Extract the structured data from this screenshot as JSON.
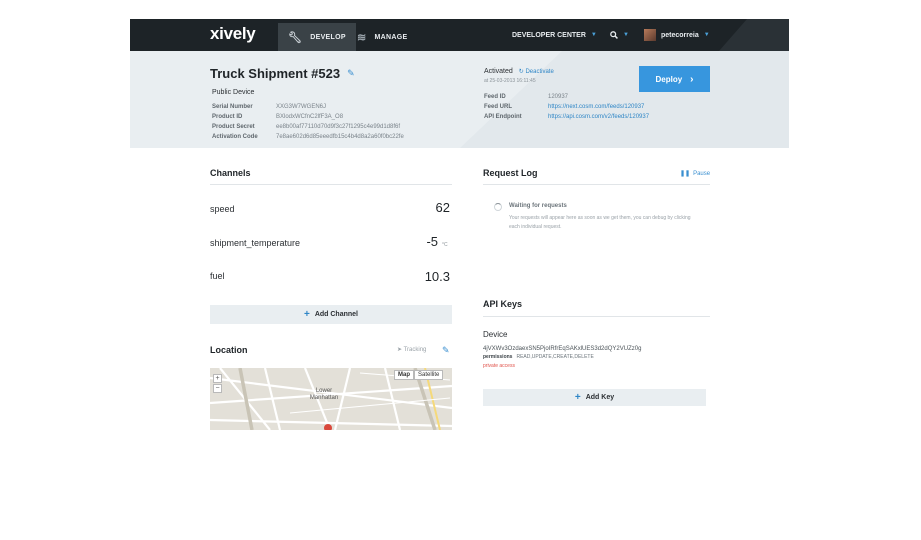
{
  "nav": {
    "logo": "xively",
    "develop": "DEVELOP",
    "manage": "MANAGE",
    "developer_center": "DEVELOPER CENTER",
    "username": "petecorreia"
  },
  "device": {
    "title": "Truck Shipment #523",
    "type": "Public Device",
    "fields": [
      {
        "label": "Serial Number",
        "value": "XXG3W7WGEN6J"
      },
      {
        "label": "Product ID",
        "value": "BXlodxWCfnC2lfF3A_O8"
      },
      {
        "label": "Product Secret",
        "value": "ee8b00af77110d70d9f3c27f1295c4e99d1d8f6f"
      },
      {
        "label": "Activation Code",
        "value": "7e8ae602d6d85eeedfb15c4b4d8a2a60f0bc22fe"
      }
    ],
    "status": "Activated",
    "deactivate": "Deactivate",
    "activated_at": "at 25-03-2013 16:11:45",
    "feed_fields": [
      {
        "label": "Feed ID",
        "value": "120937",
        "link": false
      },
      {
        "label": "Feed URL",
        "value": "https://next.cosm.com/feeds/120937",
        "link": true
      },
      {
        "label": "API Endpoint",
        "value": "https://api.cosm.com/v2/feeds/120937",
        "link": true
      }
    ],
    "deploy_label": "Deploy"
  },
  "channels": {
    "title": "Channels",
    "items": [
      {
        "name": "speed",
        "value": "62",
        "unit": ""
      },
      {
        "name": "shipment_temperature",
        "value": "-5",
        "unit": "°C"
      },
      {
        "name": "fuel",
        "value": "10.3",
        "unit": ""
      }
    ],
    "add_label": "Add Channel"
  },
  "location": {
    "title": "Location",
    "tracking": "Tracking",
    "map_button": "Map",
    "satellite_button": "Satellite",
    "zoom_in": "+",
    "zoom_out": "−",
    "map_label": "Lower Manhattan"
  },
  "request_log": {
    "title": "Request Log",
    "pause": "Pause",
    "waiting": "Waiting for requests",
    "description": "Your requests will appear here as soon as we get them, you can debug by clicking each individual request."
  },
  "api_keys": {
    "title": "API Keys",
    "key_name": "Device",
    "key_value": "4jVXWv3OzdaexSN5PjoIRfrEqSAKxlUES3d2dQY2VUZz0g",
    "permissions_label": "permissions",
    "permissions": "READ,UPDATE,CREATE,DELETE",
    "private_access": "private access",
    "add_label": "Add Key"
  }
}
